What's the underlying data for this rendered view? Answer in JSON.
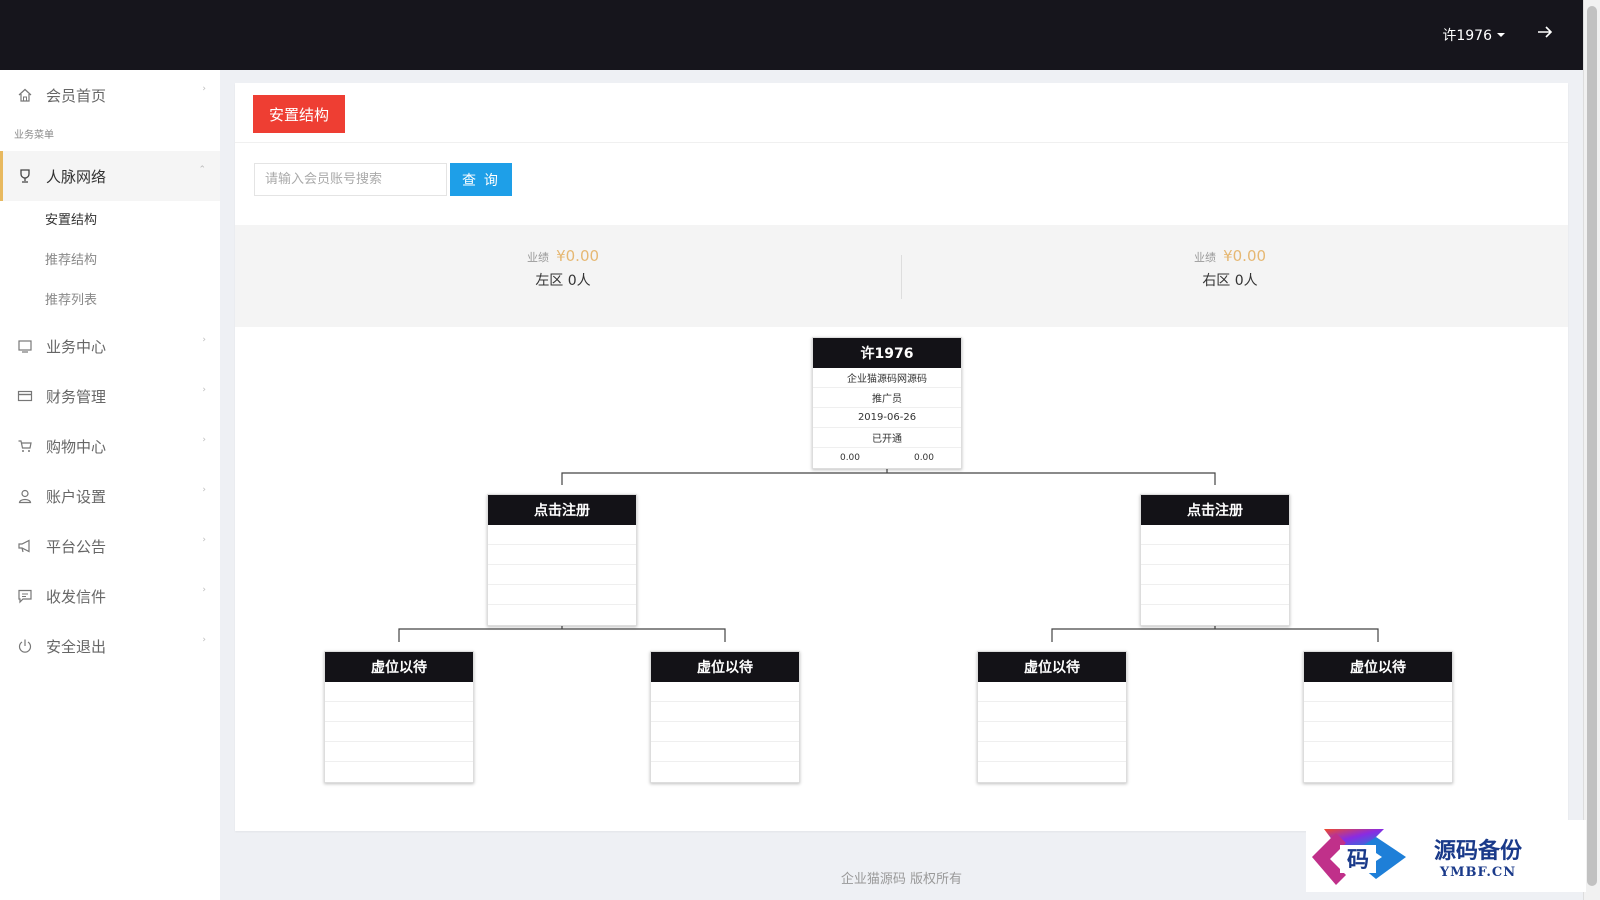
{
  "header": {
    "username": "许1976"
  },
  "sidebar": {
    "home": "会员首页",
    "section_label": "业务菜单",
    "network": "人脉网络",
    "network_sub": [
      "安置结构",
      "推荐结构",
      "推荐列表"
    ],
    "items": [
      "业务中心",
      "财务管理",
      "购物中心",
      "账户设置",
      "平台公告",
      "收发信件",
      "安全退出"
    ]
  },
  "main": {
    "tab_label": "安置结构",
    "search_placeholder": "请输入会员账号搜索",
    "search_button": "查 询",
    "left_stat": {
      "perf_label": "业绩",
      "perf_value": "¥0.00",
      "count": "左区 0人"
    },
    "right_stat": {
      "perf_label": "业绩",
      "perf_value": "¥0.00",
      "count": "右区 0人"
    }
  },
  "tree": {
    "root": {
      "name": "许1976",
      "company": "企业猫源码网源码",
      "role": "推广员",
      "date": "2019-06-26",
      "status": "已开通",
      "left_value": "0.00",
      "right_value": "0.00"
    },
    "level2_label": "点击注册",
    "level3_label": "虚位以待"
  },
  "footer": {
    "copyright": "企业猫源码 版权所有"
  },
  "watermark": {
    "glyph": "码",
    "cn": "源码备份",
    "en": "YMBF.CN"
  }
}
